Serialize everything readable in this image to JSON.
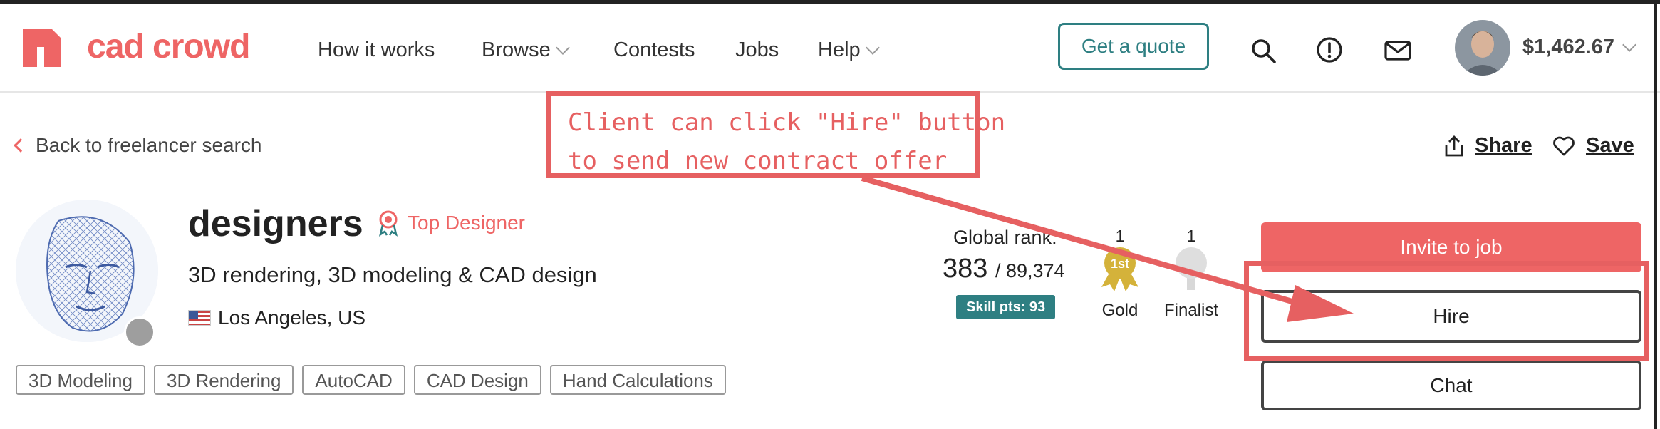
{
  "header": {
    "logo_text": "cad crowd",
    "nav": [
      {
        "label": "How it works",
        "dropdown": false
      },
      {
        "label": "Browse",
        "dropdown": true
      },
      {
        "label": "Contests",
        "dropdown": false
      },
      {
        "label": "Jobs",
        "dropdown": false
      },
      {
        "label": "Help",
        "dropdown": true
      }
    ],
    "quote_button": "Get a quote",
    "icons": [
      "search-icon",
      "alert-icon",
      "mail-icon"
    ],
    "balance": "$1,462.67"
  },
  "back_link": "Back to freelancer search",
  "actions": {
    "share": "Share",
    "save": "Save"
  },
  "profile": {
    "name": "designers",
    "badge": "Top Designer",
    "tagline": "3D rendering, 3D modeling & CAD design",
    "location": "Los Angeles, US",
    "tags": [
      "3D Modeling",
      "3D Rendering",
      "AutoCAD",
      "CAD Design",
      "Hand Calculations"
    ]
  },
  "rank": {
    "label": "Global rank:",
    "value": "383",
    "total": "/ 89,374",
    "skill_points": "Skill pts: 93"
  },
  "medals": [
    {
      "count": "1",
      "label": "Gold",
      "badge_text": "1st"
    },
    {
      "count": "1",
      "label": "Finalist",
      "badge_text": ""
    }
  ],
  "buttons": {
    "invite": "Invite to job",
    "hire": "Hire",
    "chat": "Chat"
  },
  "annotation": {
    "line1": "Client can click \"Hire\" button",
    "line2": "to send new contract offer",
    "color": "#e66061"
  },
  "colors": {
    "brand": "#ee6565",
    "teal": "#2e7f82",
    "gold": "#d4b23a"
  }
}
